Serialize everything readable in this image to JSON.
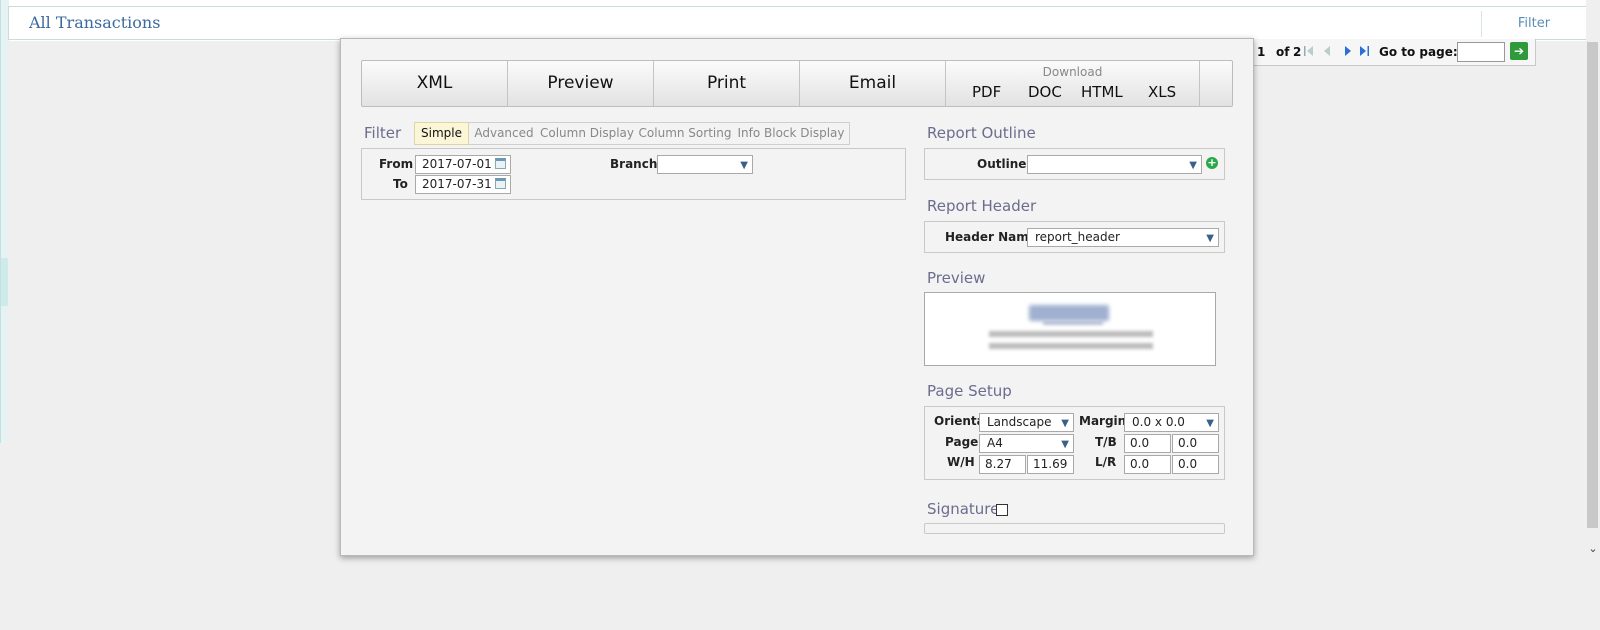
{
  "page": {
    "title": "All Transactions",
    "filter_link": "Filter"
  },
  "pager": {
    "current": "1",
    "of_label": "of",
    "total": "2",
    "goto_label": "Go to page:",
    "goto_value": ""
  },
  "toolbar": {
    "buttons": [
      "XML",
      "Preview",
      "Print",
      "Email"
    ],
    "download_label": "Download",
    "download_buttons": [
      "PDF",
      "DOC",
      "HTML",
      "XLS"
    ]
  },
  "filter": {
    "title": "Filter",
    "tabs": [
      "Simple",
      "Advanced",
      "Column Display",
      "Column Sorting",
      "Info Block Display"
    ],
    "active_tab": "Simple",
    "from_label": "From",
    "from_value": "2017-07-01",
    "to_label": "To",
    "to_value": "2017-07-31",
    "branch_label": "Branch",
    "branch_value": ""
  },
  "report_outline": {
    "title": "Report Outline",
    "outline_label": "Outline",
    "outline_value": ""
  },
  "report_header": {
    "title": "Report Header",
    "header_name_label": "Header Name",
    "header_name_value": "report_header"
  },
  "preview": {
    "title": "Preview"
  },
  "page_setup": {
    "title": "Page Setup",
    "orientation_label": "Orienta",
    "orientation_value": "Landscape",
    "page_label": "Page",
    "page_value": "A4",
    "wh_label": "W/H",
    "width": "8.27",
    "height": "11.69",
    "margin_label": "Margin",
    "margin_value": "0.0 x 0.0",
    "tb_label": "T/B",
    "top": "0.0",
    "bottom": "0.0",
    "lr_label": "L/R",
    "left": "0.0",
    "right": "0.0"
  },
  "signature": {
    "title": "Signature",
    "checked": false
  },
  "colors": {
    "title_blue": "#3a6aa0",
    "section_title": "#6c6c8e",
    "go_green": "#2f9a3a"
  }
}
